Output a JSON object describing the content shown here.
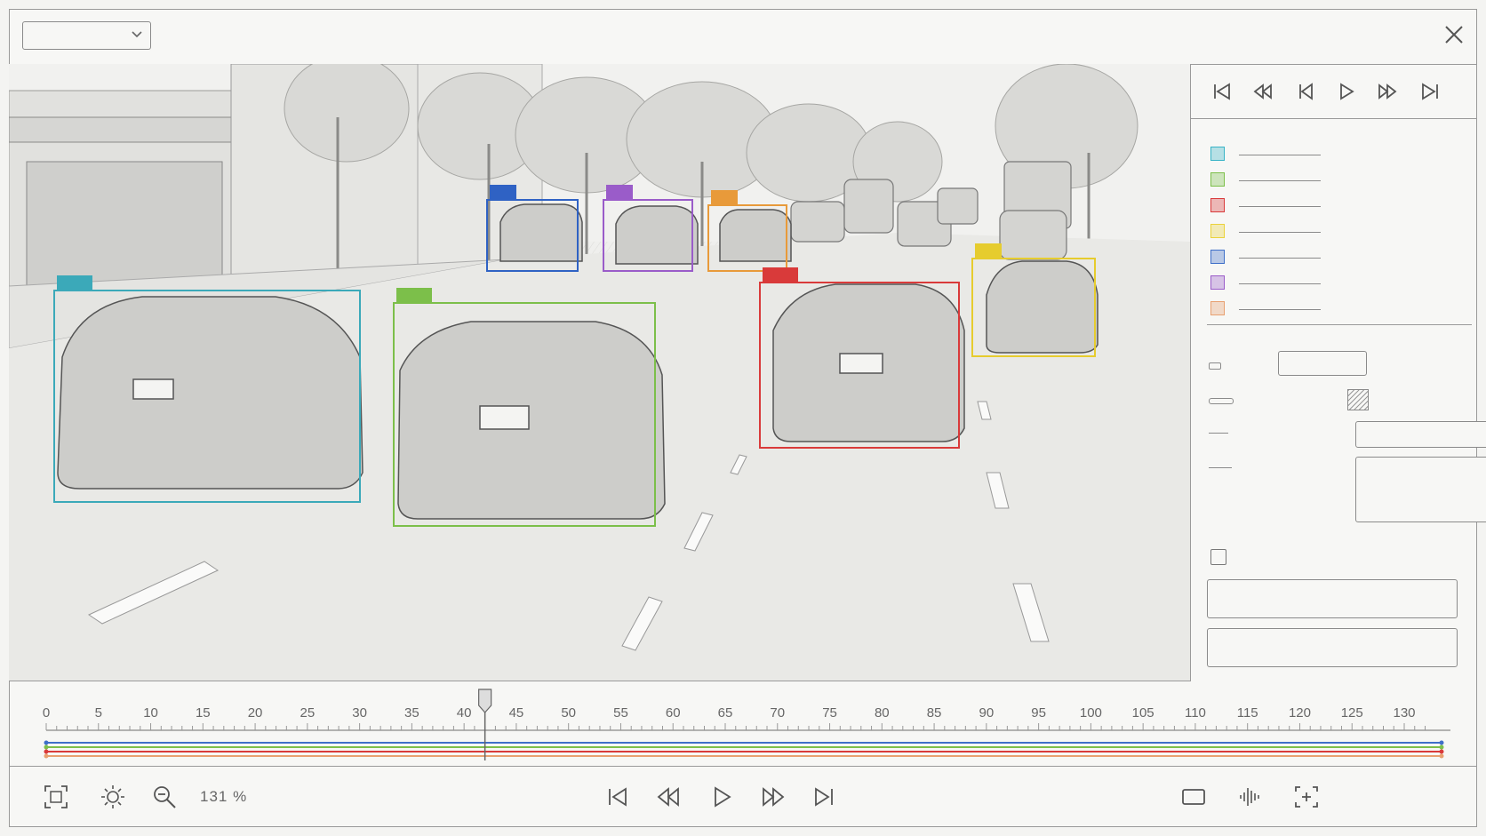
{
  "top": {
    "selector_value": ""
  },
  "panel": {
    "playback": [
      "first-frame-icon",
      "rewind-icon",
      "previous-frame-icon",
      "play-icon",
      "fast-forward-icon",
      "last-frame-icon"
    ],
    "classes": [
      {
        "id": "c1",
        "color": "#37b3c6"
      },
      {
        "id": "c2",
        "color": "#7cbf4a"
      },
      {
        "id": "c3",
        "color": "#d93a3a"
      },
      {
        "id": "c4",
        "color": "#ebd23a"
      },
      {
        "id": "c5",
        "color": "#3f6fc8"
      },
      {
        "id": "c6",
        "color": "#9a5cc9"
      },
      {
        "id": "c7",
        "color": "#e8a070"
      }
    ],
    "fields": {
      "text_value": "",
      "dropdown_value": "",
      "notes_value": ""
    }
  },
  "annotations": [
    {
      "class": "c1",
      "color": "#3ba9b9"
    },
    {
      "class": "c2",
      "color": "#7cbf4a"
    },
    {
      "class": "c5",
      "color": "#2f62c4"
    },
    {
      "class": "c6",
      "color": "#9a5cc9"
    },
    {
      "class": "c7",
      "color": "#e89a3a"
    },
    {
      "class": "c3",
      "color": "#d93a3a"
    },
    {
      "class": "c4",
      "color": "#e6cc2e"
    }
  ],
  "timeline": {
    "ticks": [
      "0",
      "5",
      "10",
      "15",
      "20",
      "25",
      "30",
      "35",
      "40",
      "45",
      "50",
      "55",
      "60",
      "65",
      "70",
      "75",
      "80",
      "85",
      "90",
      "95",
      "100",
      "105",
      "110",
      "115",
      "120",
      "125",
      "130"
    ],
    "playhead": 42,
    "track_colors": [
      "#3f6fc8",
      "#7cbf4a",
      "#d93a3a",
      "#e8a070"
    ]
  },
  "toolbar": {
    "zoom": "131 %"
  }
}
